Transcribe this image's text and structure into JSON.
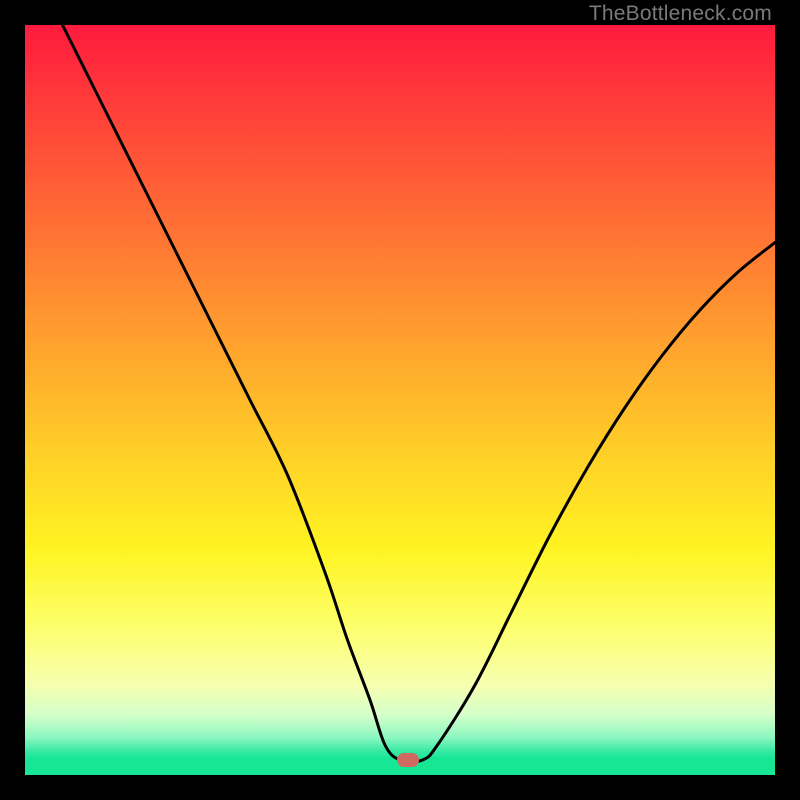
{
  "watermark": "TheBottleneck.com",
  "chart_data": {
    "type": "line",
    "title": "",
    "xlabel": "",
    "ylabel": "",
    "xlim": [
      0,
      100
    ],
    "ylim": [
      0,
      100
    ],
    "grid": false,
    "legend": false,
    "background_gradient": [
      "#ff1a3e",
      "#18e695"
    ],
    "series": [
      {
        "name": "bottleneck-curve",
        "x": [
          5,
          10,
          15,
          20,
          25,
          30,
          35,
          40,
          43,
          46,
          48,
          50,
          53,
          55,
          60,
          65,
          70,
          75,
          80,
          85,
          90,
          95,
          100
        ],
        "values": [
          100,
          90,
          80,
          70,
          60,
          50,
          40,
          27,
          18,
          10,
          4,
          2,
          2,
          4,
          12,
          22,
          32,
          41,
          49,
          56,
          62,
          67,
          71
        ]
      }
    ],
    "marker": {
      "x": 51,
      "y": 2,
      "color": "#d06a60"
    }
  }
}
